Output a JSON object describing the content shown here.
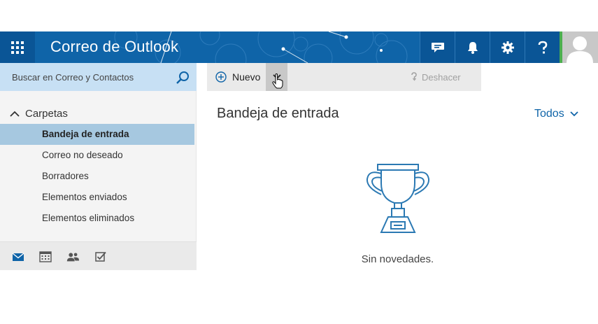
{
  "header": {
    "app_title": "Correo de Outlook",
    "colors": {
      "bar": "#0f64a8",
      "button": "#0a5596",
      "presence": "#4caf50"
    }
  },
  "search": {
    "placeholder": "Buscar en Correo y Contactos"
  },
  "command_bar": {
    "new_label": "Nuevo",
    "undo_label": "Deshacer"
  },
  "sidebar": {
    "section_label": "Carpetas",
    "folders": [
      {
        "label": "Bandeja de entrada",
        "active": true
      },
      {
        "label": "Correo no deseado"
      },
      {
        "label": "Borradores"
      },
      {
        "label": "Elementos enviados"
      },
      {
        "label": "Elementos eliminados"
      }
    ],
    "bottom_icons": [
      "mail-icon",
      "calendar-icon",
      "people-icon",
      "tasks-icon"
    ]
  },
  "main": {
    "title": "Bandeja de entrada",
    "filter_label": "Todos",
    "empty_message": "Sin novedades."
  }
}
